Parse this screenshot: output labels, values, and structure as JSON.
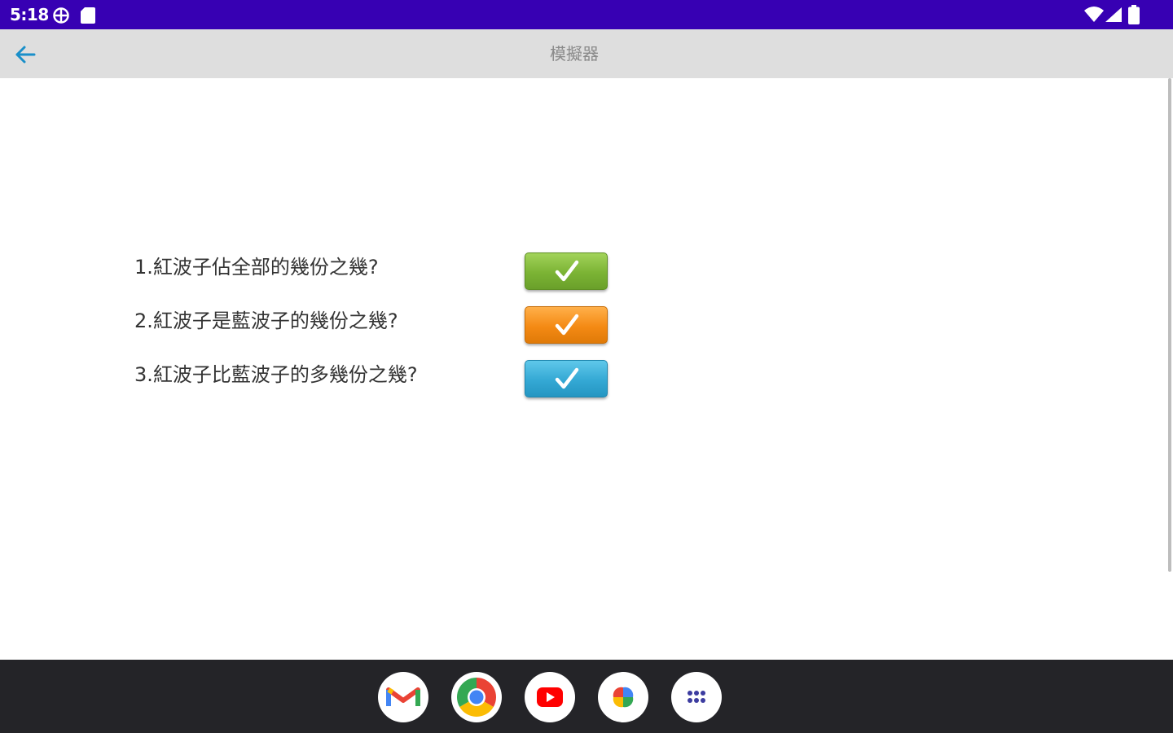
{
  "status_bar": {
    "time": "5:18",
    "icons": [
      "vpn-icon",
      "sd-card-icon",
      "wifi-icon",
      "signal-icon",
      "battery-icon"
    ],
    "background": "#3700b3"
  },
  "app_bar": {
    "title": "模擬器",
    "back_icon": "back-arrow-icon",
    "accent": "#1a8fc9"
  },
  "questions": [
    {
      "text": "1.紅波子佔全部的幾份之幾?",
      "button_color": "#7bb334"
    },
    {
      "text": "2.紅波子是藍波子的幾份之幾?",
      "button_color": "#f48a14"
    },
    {
      "text": "3.紅波子比藍波子的多幾份之幾?",
      "button_color": "#34a8d4"
    }
  ],
  "taskbar": {
    "apps": [
      "gmail-icon",
      "chrome-icon",
      "youtube-icon",
      "photos-icon",
      "app-drawer-icon"
    ]
  }
}
